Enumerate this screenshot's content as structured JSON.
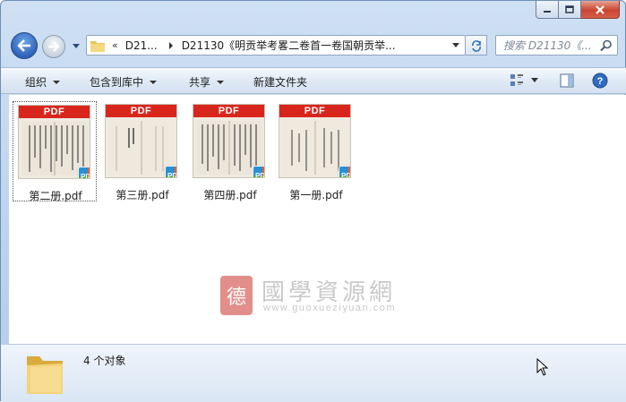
{
  "window": {
    "caption_buttons": [
      "minimize",
      "maximize",
      "close"
    ]
  },
  "nav": {
    "back_icon": "back-arrow-icon",
    "forward_icon": "forward-arrow-icon"
  },
  "address": {
    "overflow": "«",
    "crumb1": "D21...",
    "crumb2": "D21130《明贡举考畧二卷首一卷国朝贡举..."
  },
  "search": {
    "placeholder": "搜索 D21130《..."
  },
  "toolbar": {
    "organize": "组织",
    "include_library": "包含到库中",
    "share": "共享",
    "new_folder": "新建文件夹"
  },
  "files": [
    {
      "name": "第二册.pdf",
      "badge": "PDF",
      "band": "PDF",
      "selected": true
    },
    {
      "name": "第三册.pdf",
      "badge": "PDF",
      "band": "PDF",
      "selected": false
    },
    {
      "name": "第四册.pdf",
      "badge": "PDF",
      "band": "PDF",
      "selected": false
    },
    {
      "name": "第一册.pdf",
      "badge": "PDF",
      "band": "PDF",
      "selected": false
    }
  ],
  "watermark": {
    "seal": "德",
    "title": "國學資源網",
    "url": "www.guoxueziyuan.com"
  },
  "status": {
    "count_text": "4 个对象"
  },
  "colors": {
    "pdf_red": "#d9261c",
    "accent_blue": "#2f63b8"
  }
}
